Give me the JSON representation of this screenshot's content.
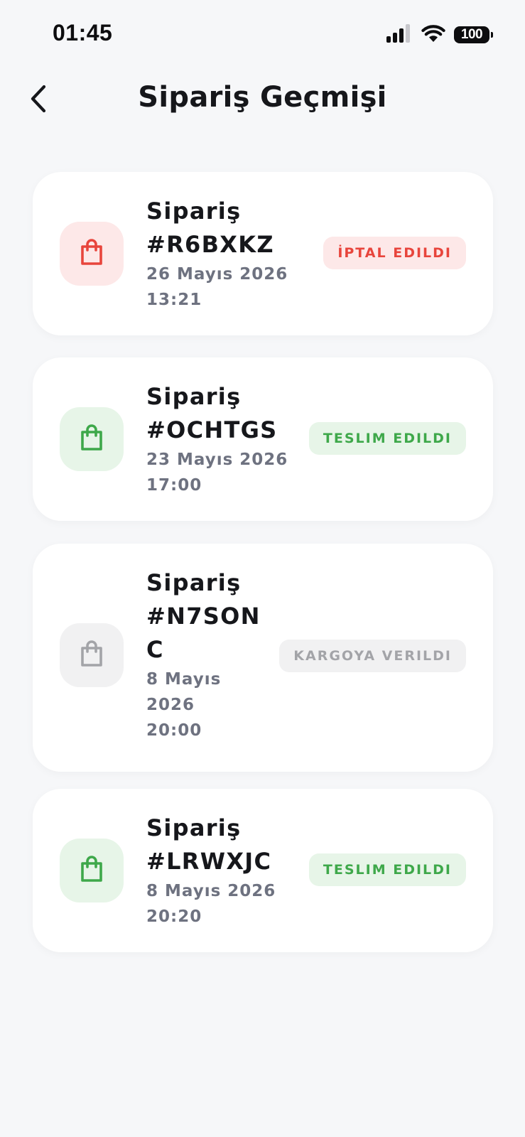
{
  "status_bar": {
    "time": "01:45",
    "battery": "100"
  },
  "header": {
    "title": "Sipariş Geçmişi"
  },
  "colors": {
    "red": "#e8453c",
    "green": "#3ea84a",
    "gray": "#a3a4a8"
  },
  "orders": [
    {
      "title_line1": "Sipariş",
      "title_line2": "#R6BXKZ",
      "title_line3": "",
      "date_line1": "26 Mayıs 2026",
      "date_line2": "13:21",
      "date_line3": "",
      "status": "İPTAL EDILDI",
      "status_color": "red",
      "icon": "shopping-bag-icon"
    },
    {
      "title_line1": "Sipariş",
      "title_line2": "#OCHTGS",
      "title_line3": "",
      "date_line1": "23 Mayıs 2026",
      "date_line2": "17:00",
      "date_line3": "",
      "status": "TESLIM EDILDI",
      "status_color": "green",
      "icon": "shopping-bag-icon"
    },
    {
      "title_line1": "Sipariş",
      "title_line2": "#N7SON",
      "title_line3": "C",
      "date_line1": "8 Mayıs",
      "date_line2": "2026",
      "date_line3": "20:00",
      "status": "KARGOYA VERILDI",
      "status_color": "gray",
      "icon": "shopping-bag-icon"
    },
    {
      "title_line1": "Sipariş",
      "title_line2": "#LRWXJC",
      "title_line3": "",
      "date_line1": "8 Mayıs 2026",
      "date_line2": "20:20",
      "date_line3": "",
      "status": "TESLIM EDILDI",
      "status_color": "green",
      "icon": "shopping-bag-icon"
    }
  ]
}
